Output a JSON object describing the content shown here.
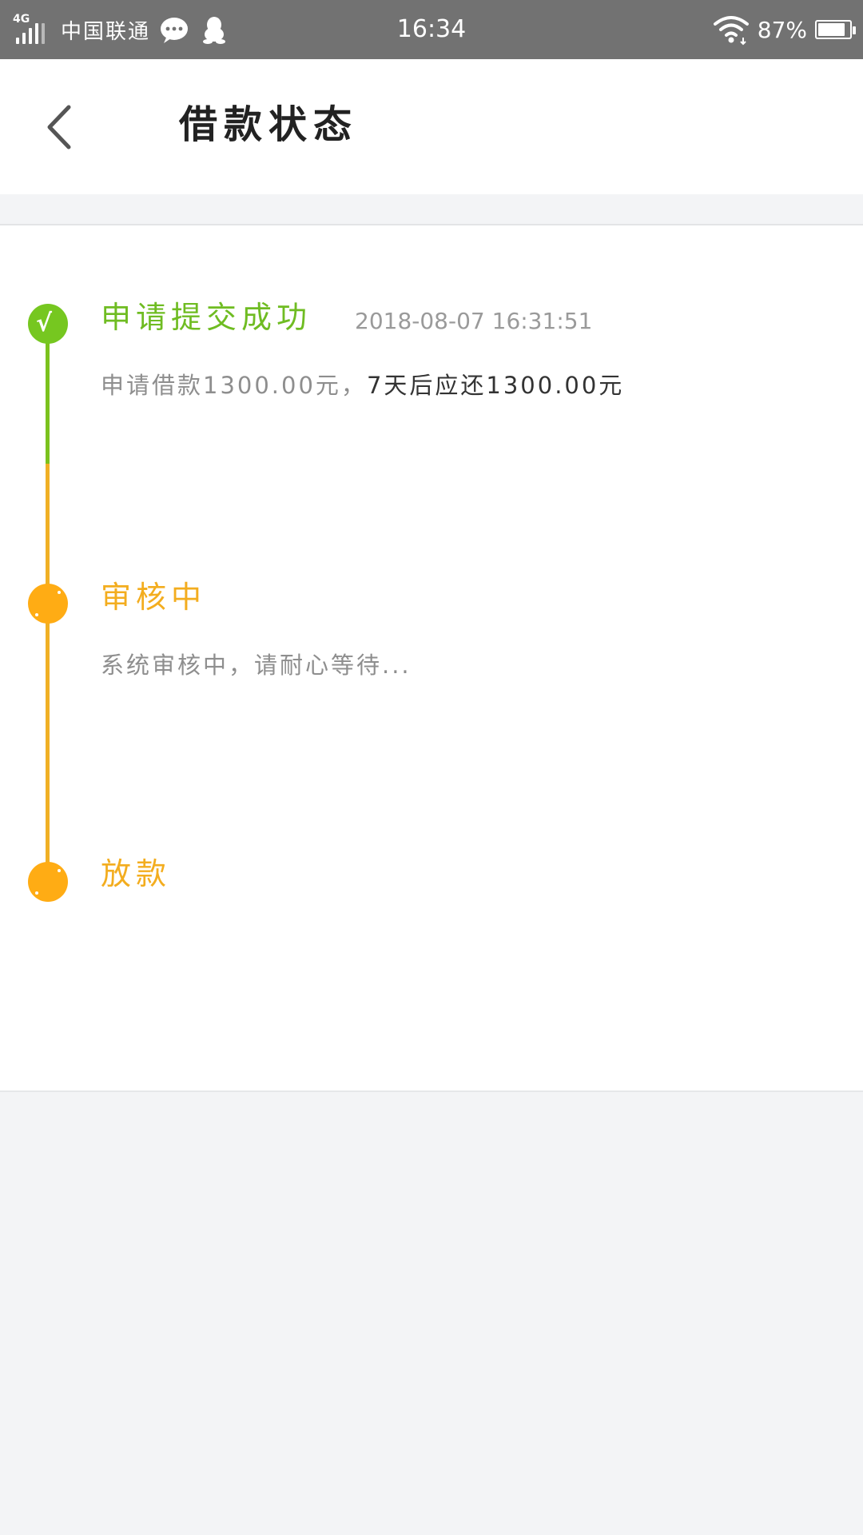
{
  "status_bar": {
    "network": "4G",
    "carrier": "中国联通",
    "time": "16:34",
    "battery_percent": "87%",
    "battery_level": 0.87,
    "icons": [
      "signal-icon",
      "chat-bubble-icon",
      "qq-penguin-icon",
      "wifi-icon",
      "battery-icon"
    ]
  },
  "header": {
    "title": "借款状态",
    "back_icon": "chevron-left-icon"
  },
  "timeline": {
    "colors": {
      "done": "#76c720",
      "pending": "#ffac14",
      "line_done": "#7bc21d",
      "line_pending": "#f0b025"
    },
    "steps": [
      {
        "title": "申请提交成功",
        "time": "2018-08-07 16:31:51",
        "desc_prefix": "申请借款1300.00元，",
        "desc_suffix": "7天后应还1300.00元",
        "state": "done"
      },
      {
        "title": "审核中",
        "desc": "系统审核中，请耐心等待...",
        "state": "pending"
      },
      {
        "title": "放款",
        "state": "pending"
      }
    ]
  }
}
